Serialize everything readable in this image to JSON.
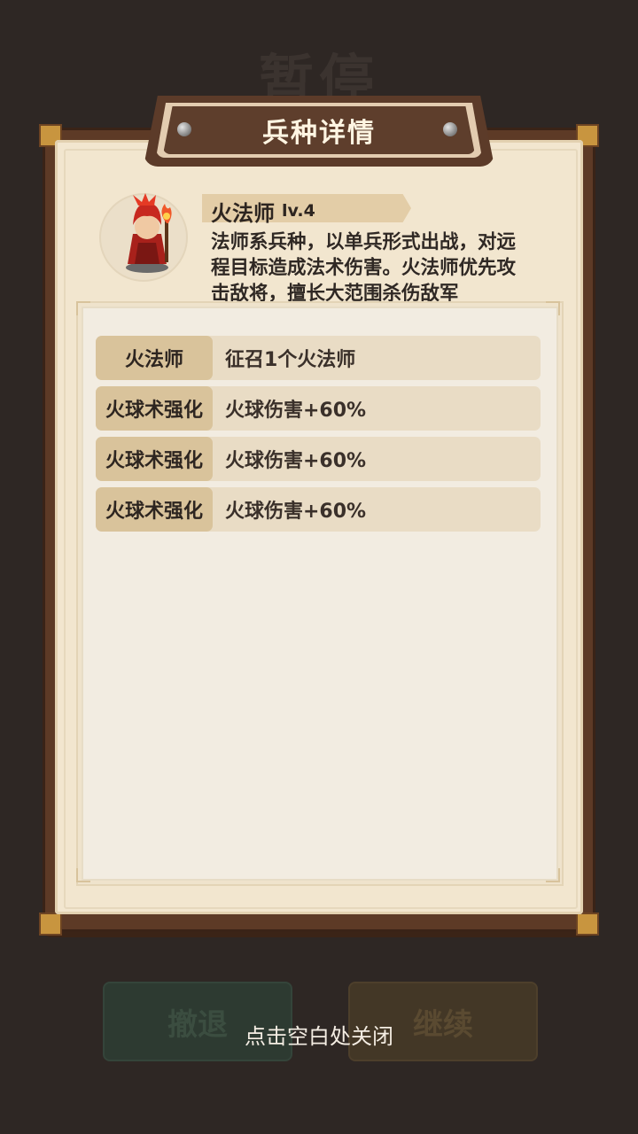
{
  "background": {
    "pause_title": "暂停",
    "retreat_label": "撤退",
    "continue_label": "继续"
  },
  "dialog": {
    "title": "兵种详情",
    "unit": {
      "name": "火法师",
      "level": "lv.4",
      "description": "法师系兵种，以单兵形式出战，对远程目标造成法术伤害。火法师优先攻击敌将，擅长大范围杀伤敌军"
    },
    "upgrades": [
      {
        "name": "火法师",
        "effect": "征召1个火法师"
      },
      {
        "name": "火球术强化",
        "effect": "火球伤害+60%"
      },
      {
        "name": "火球术强化",
        "effect": "火球伤害+60%"
      },
      {
        "name": "火球术强化",
        "effect": "火球伤害+60%"
      }
    ]
  },
  "close_hint": "点击空白处关闭",
  "colors": {
    "overlay": "#2e2724",
    "panel_wood": "#5d3a26",
    "parchment": "#f2e6cf",
    "row_key": "#d9c39b",
    "row_value": "#e9dcc5"
  },
  "icons": {
    "portrait": "fire-mage-portrait-icon",
    "rivet": "rivet-icon"
  }
}
